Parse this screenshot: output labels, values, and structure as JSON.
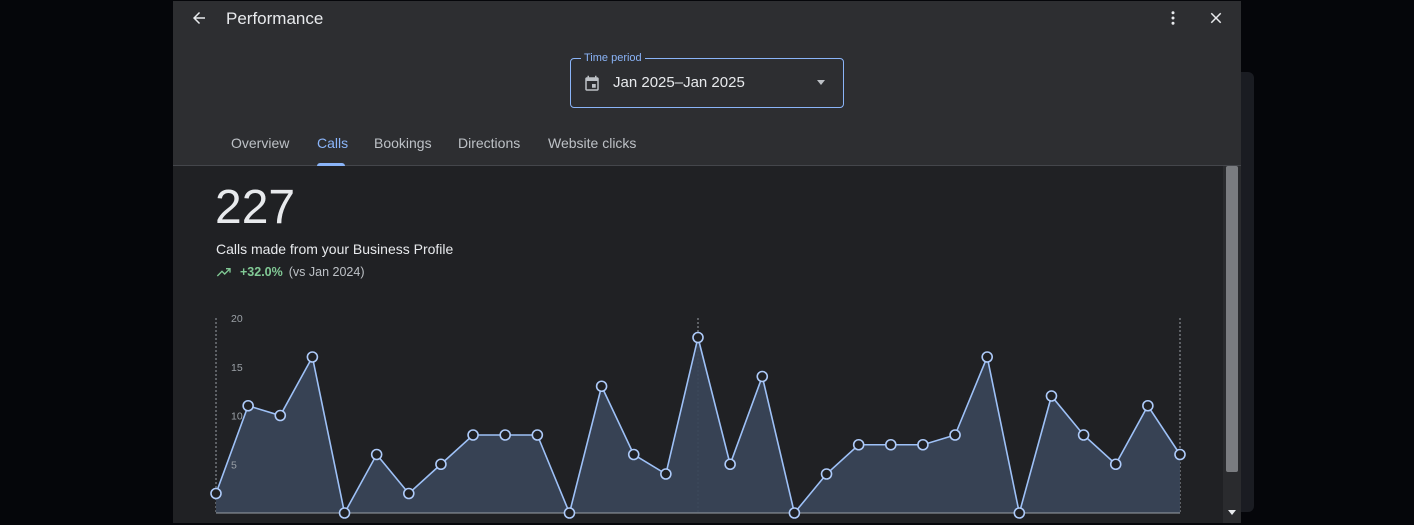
{
  "header": {
    "title": "Performance",
    "back_icon": "arrow-back-icon",
    "more_icon": "more-vert-icon",
    "close_icon": "close-icon"
  },
  "time_period": {
    "label": "Time period",
    "value": "Jan 2025–Jan 2025",
    "icon": "calendar-icon"
  },
  "tabs": [
    {
      "label": "Overview",
      "active": false
    },
    {
      "label": "Calls",
      "active": true
    },
    {
      "label": "Bookings",
      "active": false
    },
    {
      "label": "Directions",
      "active": false
    },
    {
      "label": "Website clicks",
      "active": false
    }
  ],
  "metric": {
    "value": "227",
    "label": "Calls made from your Business Profile",
    "change": "+32.0%",
    "comparison": "(vs Jan 2024)"
  },
  "colors": {
    "accent": "#8ab4f8",
    "positive": "#81c995",
    "background": "#202124",
    "header": "#2d2e31"
  },
  "chart_data": {
    "type": "area",
    "title": "",
    "xlabel": "",
    "ylabel": "",
    "ylim": [
      0,
      20
    ],
    "yticks": [
      "20",
      "15",
      "10",
      "5"
    ],
    "grid": false,
    "x": [
      1,
      2,
      3,
      4,
      5,
      6,
      7,
      8,
      9,
      10,
      11,
      12,
      13,
      14,
      15,
      16,
      17,
      18,
      19,
      20,
      21,
      22,
      23,
      24,
      25,
      26,
      27,
      28,
      29,
      30,
      31
    ],
    "series": [
      {
        "values": [
          2,
          11,
          10,
          16,
          0,
          6,
          2,
          5,
          8,
          8,
          8,
          0,
          13,
          6,
          4,
          18,
          5,
          14,
          0,
          4,
          7,
          7,
          7,
          8,
          16,
          0,
          12,
          8,
          5,
          11,
          6
        ]
      }
    ]
  }
}
